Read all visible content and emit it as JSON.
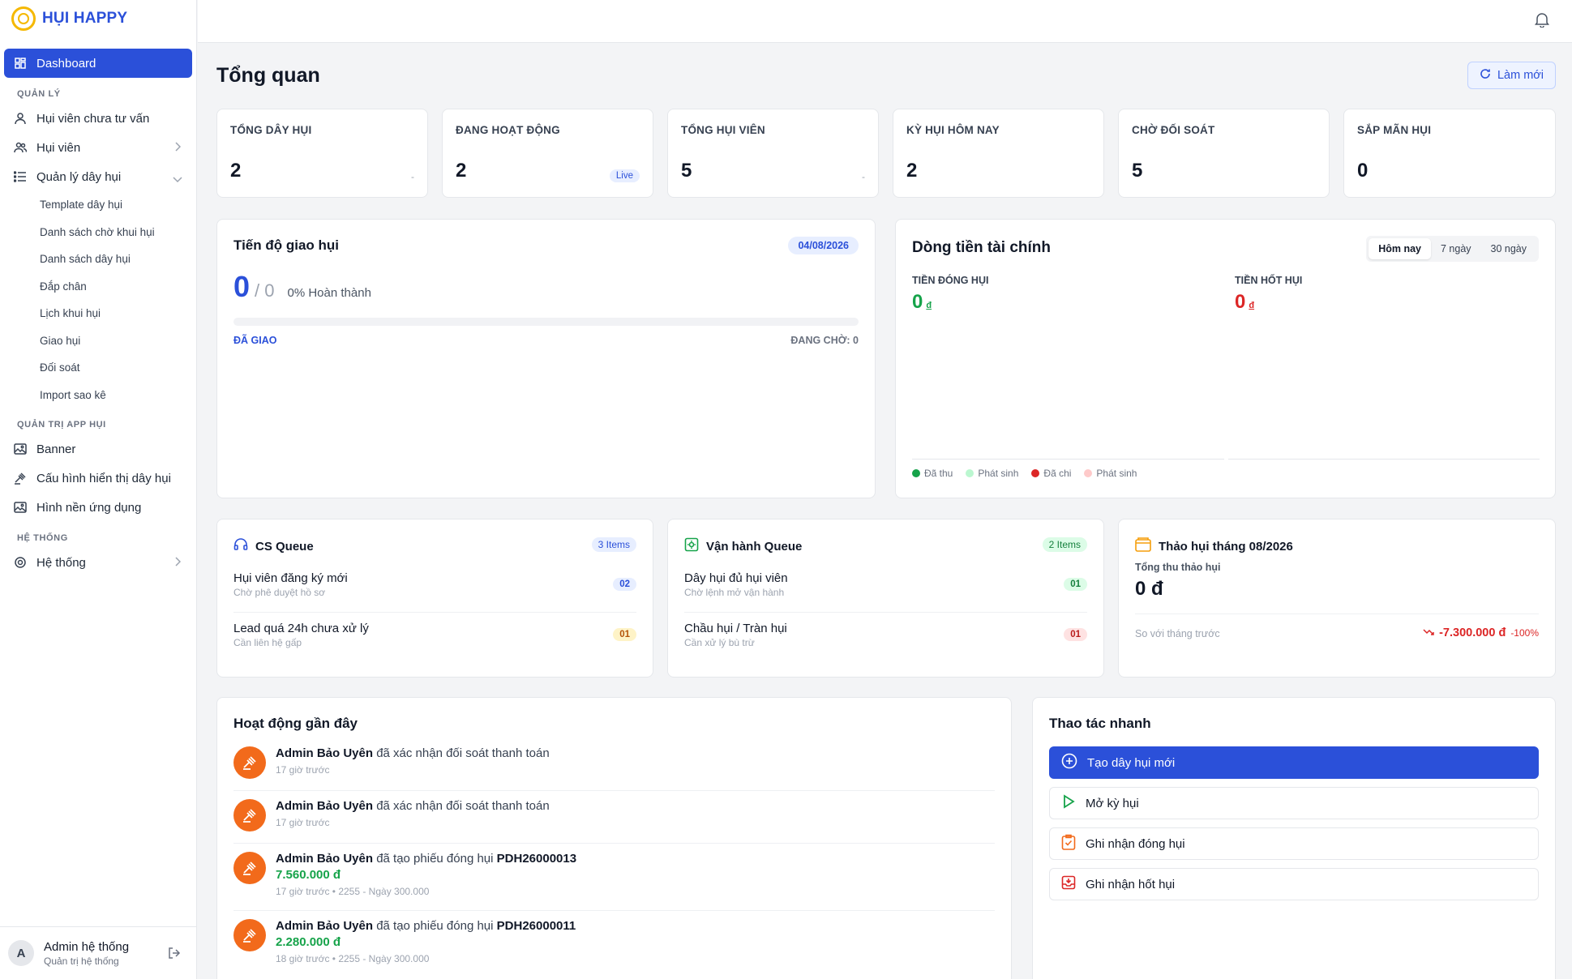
{
  "brand": {
    "name": "HỤI HAPPY"
  },
  "sidebar": {
    "dashboard": "Dashboard",
    "section_manage": "QUẢN LÝ",
    "items": [
      {
        "label": "Hụi viên chưa tư vấn",
        "icon": "user-icon"
      },
      {
        "label": "Hụi viên",
        "icon": "users-icon"
      },
      {
        "label": "Quản lý dây hụi",
        "icon": "list-icon"
      }
    ],
    "sub_items": [
      "Template dây hụi",
      "Danh sách chờ khui hụi",
      "Danh sách dây hụi",
      "Đắp chân",
      "Lịch khui hụi",
      "Giao hụi",
      "Đối soát",
      "Import sao kê"
    ],
    "section_app": "QUẢN TRỊ APP HỤI",
    "app_items": [
      {
        "label": "Banner",
        "icon": "image-icon"
      },
      {
        "label": "Cấu hình hiển thị dây hụi",
        "icon": "gavel-icon"
      },
      {
        "label": "Hình nền ứng dụng",
        "icon": "image-icon"
      }
    ],
    "section_system": "HỆ THỐNG",
    "system_item": "Hệ thống",
    "user": {
      "initial": "A",
      "name": "Admin hệ thống",
      "role": "Quản trị hệ thống"
    }
  },
  "page": {
    "title": "Tổng quan",
    "refresh_label": "Làm mới"
  },
  "stats": [
    {
      "label": "TỔNG DÂY HỤI",
      "value": "2",
      "extra": "-"
    },
    {
      "label": "ĐANG HOẠT ĐỘNG",
      "value": "2",
      "extra": "Live"
    },
    {
      "label": "TỔNG HỤI VIÊN",
      "value": "5",
      "extra": "-"
    },
    {
      "label": "KỲ HỤI HÔM NAY",
      "value": "2",
      "extra": ""
    },
    {
      "label": "CHỜ ĐỐI SOÁT",
      "value": "5",
      "extra": ""
    },
    {
      "label": "SẮP MÃN HỤI",
      "value": "0",
      "extra": ""
    }
  ],
  "progress": {
    "title": "Tiến độ giao hụi",
    "date": "04/08/2026",
    "done": "0",
    "total": "/ 0",
    "percent_label": "0% Hoàn thành",
    "percent_value": 0,
    "left_label": "ĐÃ GIAO",
    "right_label": "ĐANG CHỜ: 0"
  },
  "finance": {
    "title": "Dòng tiền tài chính",
    "tabs": [
      "Hôm nay",
      "7 ngày",
      "30 ngày"
    ],
    "in_label": "TIỀN ĐÓNG HỤI",
    "in_value": "0",
    "out_label": "TIỀN HỐT HỤI",
    "out_value": "0",
    "currency": "đ",
    "legend": [
      {
        "label": "Đã thu",
        "color": "#16a34a"
      },
      {
        "label": "Phát sinh",
        "color": "#bbf7d0"
      },
      {
        "label": "Đã chi",
        "color": "#dc2626"
      },
      {
        "label": "Phát sinh",
        "color": "#fecaca"
      }
    ]
  },
  "cs_queue": {
    "title": "CS Queue",
    "badge": "3 Items",
    "rows": [
      {
        "title": "Hụi viên đăng ký mới",
        "sub": "Chờ phê duyệt hồ sơ",
        "count": "02"
      },
      {
        "title": "Lead quá 24h chưa xử lý",
        "sub": "Cần liên hệ gấp",
        "count": "01"
      }
    ]
  },
  "ops_queue": {
    "title": "Vận hành Queue",
    "badge": "2 Items",
    "rows": [
      {
        "title": "Dây hụi đủ hụi viên",
        "sub": "Chờ lệnh mở vận hành",
        "count": "01"
      },
      {
        "title": "Chầu hụi / Tràn hụi",
        "sub": "Cần xử lý bù trừ",
        "count": "01"
      }
    ]
  },
  "thao_hui": {
    "title": "Thảo hụi tháng 08/2026",
    "sub": "Tổng thu thảo hụi",
    "value": "0 đ",
    "compare_label": "So với tháng trước",
    "compare_value": "-7.300.000 đ",
    "compare_pct": "-100%"
  },
  "activity": {
    "title": "Hoạt động gần đây",
    "items": [
      {
        "actor": "Admin Bảo Uyên",
        "action": "đã xác nhận đối soát thanh toán",
        "code": "",
        "amount": "",
        "time": "17 giờ trước"
      },
      {
        "actor": "Admin Bảo Uyên",
        "action": "đã xác nhận đối soát thanh toán",
        "code": "",
        "amount": "",
        "time": "17 giờ trước"
      },
      {
        "actor": "Admin Bảo Uyên",
        "action": "đã tạo phiếu đóng hụi",
        "code": "PDH26000013",
        "amount": "7.560.000 đ",
        "time": "17 giờ trước • 2255 - Ngày 300.000"
      },
      {
        "actor": "Admin Bảo Uyên",
        "action": "đã tạo phiếu đóng hụi",
        "code": "PDH26000011",
        "amount": "2.280.000 đ",
        "time": "18 giờ trước • 2255 - Ngày 300.000"
      }
    ]
  },
  "quick": {
    "title": "Thao tác nhanh",
    "buttons": [
      "Tạo dây hụi mới",
      "Mở kỳ hụi",
      "Ghi nhận đóng hụi",
      "Ghi nhận hốt hụi"
    ]
  },
  "colors": {
    "primary": "#2b50d9",
    "accent_orange": "#f26a1b",
    "success": "#16a34a",
    "danger": "#dc2626"
  }
}
